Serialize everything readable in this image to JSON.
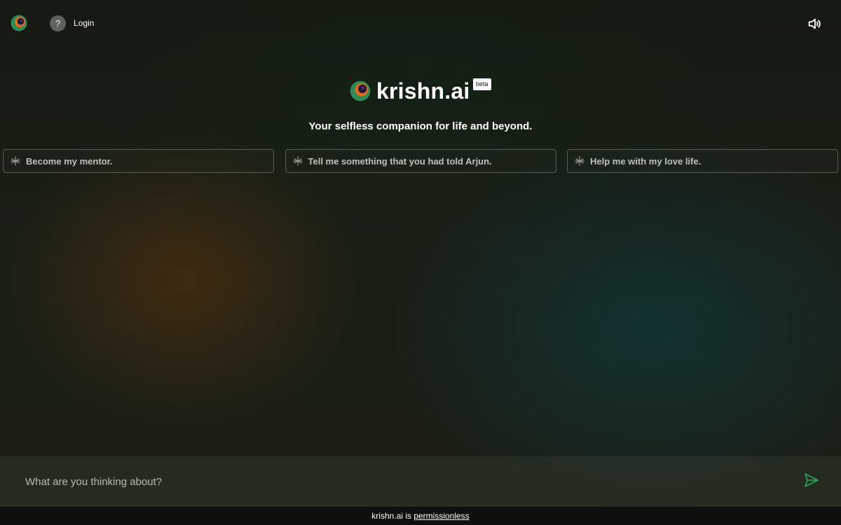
{
  "header": {
    "logo_icon": "krishn-logo-icon",
    "help_label": "?",
    "login_label": "Login",
    "sound_icon": "speaker-volume-icon"
  },
  "hero": {
    "brand_name": "krishn.ai",
    "badge": "beta",
    "tagline": "Your selfless companion for life and beyond."
  },
  "suggestions": [
    {
      "icon": "asterisk-icon",
      "label": "Become my mentor."
    },
    {
      "icon": "asterisk-icon",
      "label": "Tell me something that you had told Arjun."
    },
    {
      "icon": "asterisk-icon",
      "label": "Help me with my love life."
    }
  ],
  "chat": {
    "placeholder": "What are you thinking about?",
    "value": "",
    "send_icon": "send-icon"
  },
  "footer": {
    "prefix": "krishn.ai is",
    "link_label": "permissionless"
  },
  "colors": {
    "background": "#171b13",
    "logo_green": "#2e8a57",
    "logo_orange": "#e06a1f",
    "logo_navy": "#1a1a3c",
    "send_green": "#2e9e5b",
    "card_border": "#5a5e55",
    "footer_bg": "#0f100d"
  }
}
